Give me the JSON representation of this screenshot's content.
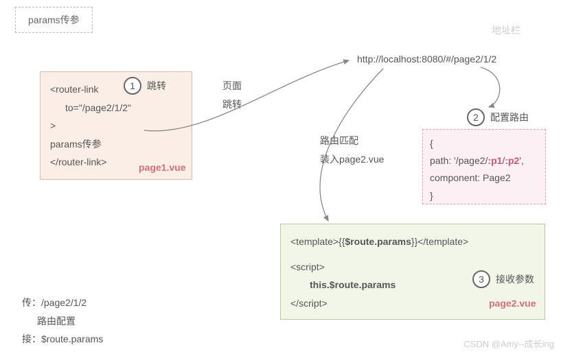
{
  "title_box": "params传参",
  "addr_label": "地址栏",
  "url": "http://localhost:8080/#/page2/1/2",
  "step1": {
    "num": "1",
    "label": "跳转"
  },
  "step2": {
    "num": "2",
    "label": "配置路由"
  },
  "step3": {
    "num": "3",
    "label": "接收参数"
  },
  "page1": {
    "l1": "<router-link",
    "l2": "to=\"/page2/1/2\"",
    "l3": ">",
    "l4": "params传参",
    "l5": "</router-link>",
    "file": "page1.vue"
  },
  "mid": {
    "l1": "页面",
    "l2": "跳转",
    "l3": "路由匹配",
    "l4": "装入page2.vue"
  },
  "route": {
    "l1": "{",
    "l2a": "path: '/page2/",
    "l2b": ":p1",
    "l2c": "/",
    "l2d": ":p2",
    "l2e": "',",
    "l3": "component: Page2",
    "l4": "}"
  },
  "page2": {
    "l1a": "<template>{{",
    "l1b": "$route.params",
    "l1c": "}}</template>",
    "l2": "<script>",
    "l3": "this.$route.params",
    "l4": "</script>",
    "file": "page2.vue"
  },
  "summary": {
    "l1": "传：/page2/1/2",
    "l2": "路由配置",
    "l3": "接：$route.params"
  },
  "watermark": "CSDN @Amy--成长ing"
}
